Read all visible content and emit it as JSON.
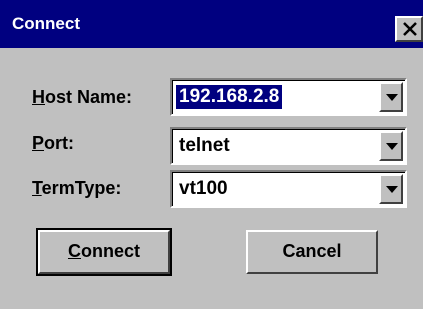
{
  "window": {
    "title": "Connect",
    "close_glyph": "×"
  },
  "fields": {
    "host": {
      "label_mnemonic": "H",
      "label_rest": "ost Name:",
      "value": "192.168.2.8"
    },
    "port": {
      "label_mnemonic": "P",
      "label_rest": "ort:",
      "value": "telnet"
    },
    "termtype": {
      "label_mnemonic": "T",
      "label_rest": "ermType:",
      "value": "vt100"
    }
  },
  "buttons": {
    "connect": {
      "mnemonic": "C",
      "rest": "onnect"
    },
    "cancel": {
      "label": "Cancel"
    }
  },
  "icons": {
    "close": "close-icon",
    "dropdown": "chevron-down-icon"
  },
  "colors": {
    "titlebar": "#000080",
    "face": "#c0c0c0",
    "selection": "#000080"
  }
}
